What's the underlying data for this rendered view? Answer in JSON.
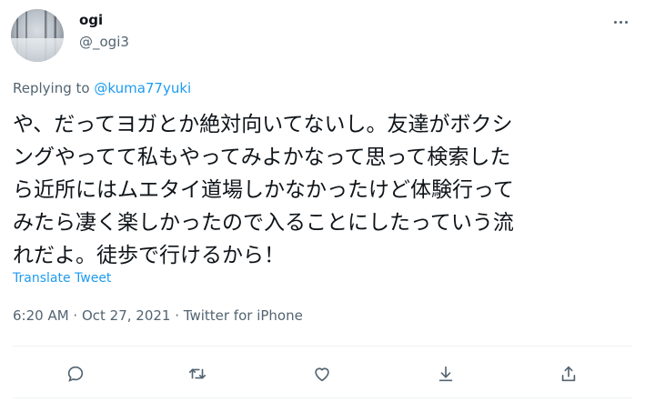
{
  "user": {
    "display_name": "ogi",
    "handle": "@_ogi3"
  },
  "reply": {
    "prefix": "Replying to ",
    "mention": "@kuma77yuki"
  },
  "tweet": {
    "text": "や、だってヨガとか絶対向いてないし。友達がボクシ\nングやってて私もやってみよかなって思って検索した\nら近所にはムエタイ道場しかなかったけど体験行って\nみたら凄く楽しかったので入ることにしたっていう流\nれだよ。徒歩で行けるから！",
    "translate_label": "Translate Tweet",
    "meta": "6:20 AM · Oct 27, 2021 · Twitter for iPhone"
  },
  "icons": {
    "more": "more-horizontal-icon",
    "reply": "reply-icon",
    "retweet": "retweet-icon",
    "like": "heart-icon",
    "bookmark": "bookmark-download-icon",
    "share": "share-icon"
  },
  "colors": {
    "text": "#0f1419",
    "secondary": "#536471",
    "accent": "#1d9bf0",
    "divider": "#eff3f4"
  }
}
